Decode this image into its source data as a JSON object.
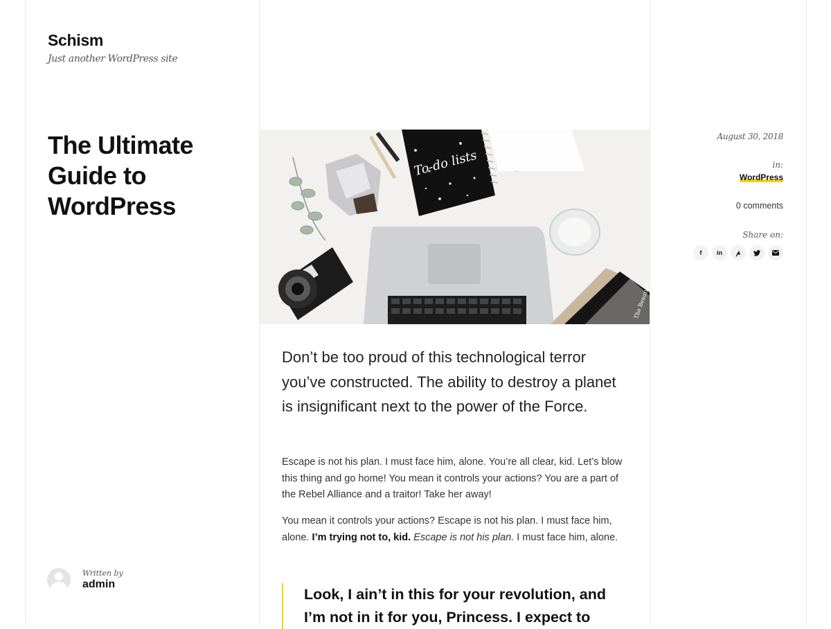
{
  "site": {
    "title": "Schism",
    "tagline": "Just another WordPress site"
  },
  "post": {
    "title": "The Ultimate Guide to WordPress",
    "date": "August 30, 2018",
    "in_label": "in:",
    "category": "WordPress",
    "comments": "0 comments",
    "share_label": "Share on:",
    "share_icons": [
      "facebook-icon",
      "linkedin-icon",
      "pinterest-icon",
      "twitter-icon",
      "email-icon"
    ]
  },
  "author": {
    "written_by": "Written by",
    "name": "admin"
  },
  "content": {
    "lead": "Don’t be too proud of this technological terror you’ve constructed. The ability to destroy a planet is insignificant next to the power of the Force.",
    "p1": "Escape is not his plan. I must face him, alone. You’re all clear, kid. Let’s blow this thing and go home! You mean it controls your actions? You are a part of the Rebel Alliance and a traitor! Take her away!",
    "p2_a": "You mean it controls your actions? Escape is not his plan. I must face him, alone. ",
    "p2_bold": "I’m trying not to, kid.",
    "p2_italic": "Escape is not his plan.",
    "p2_b": " I must face him, alone.",
    "quote": "Look, I ain’t in this for your revolution, and I’m not in it for you, Princess. I expect to"
  },
  "hero_image": {
    "notebook_text": "To-do lists",
    "book_text": "The Beautiful Humans"
  },
  "colors": {
    "accent": "#f5d400",
    "border": "#ececec"
  }
}
